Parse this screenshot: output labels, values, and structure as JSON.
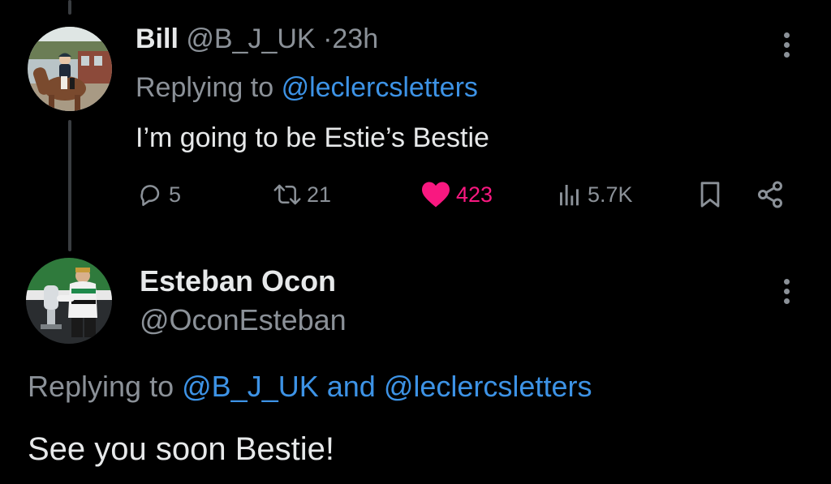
{
  "colors": {
    "background": "#000000",
    "text_primary": "#e7e9ea",
    "text_secondary": "#8b9198",
    "link": "#3d93e6",
    "like_active": "#f91880"
  },
  "tweet1": {
    "display_name": "Bill",
    "handle": "@B_J_UK",
    "separator": "·",
    "time": "23h",
    "replying_prefix": "Replying to",
    "replying_to": "@leclercsletters",
    "text": "I’m going to be Estie’s Bestie",
    "avatar_icon": "horse-rider-avatar-icon",
    "actions": {
      "replies": "5",
      "reposts": "21",
      "likes": "423",
      "views": "5.7K"
    }
  },
  "tweet2": {
    "display_name": "Esteban Ocon",
    "handle": "@OconEsteban",
    "replying_prefix": "Replying to",
    "replying_to_1": "@B_J_UK",
    "replying_conjunction": "and",
    "replying_to_2": "@leclercsletters",
    "text": "See you soon Bestie!",
    "avatar_icon": "driver-trophy-avatar-icon"
  }
}
